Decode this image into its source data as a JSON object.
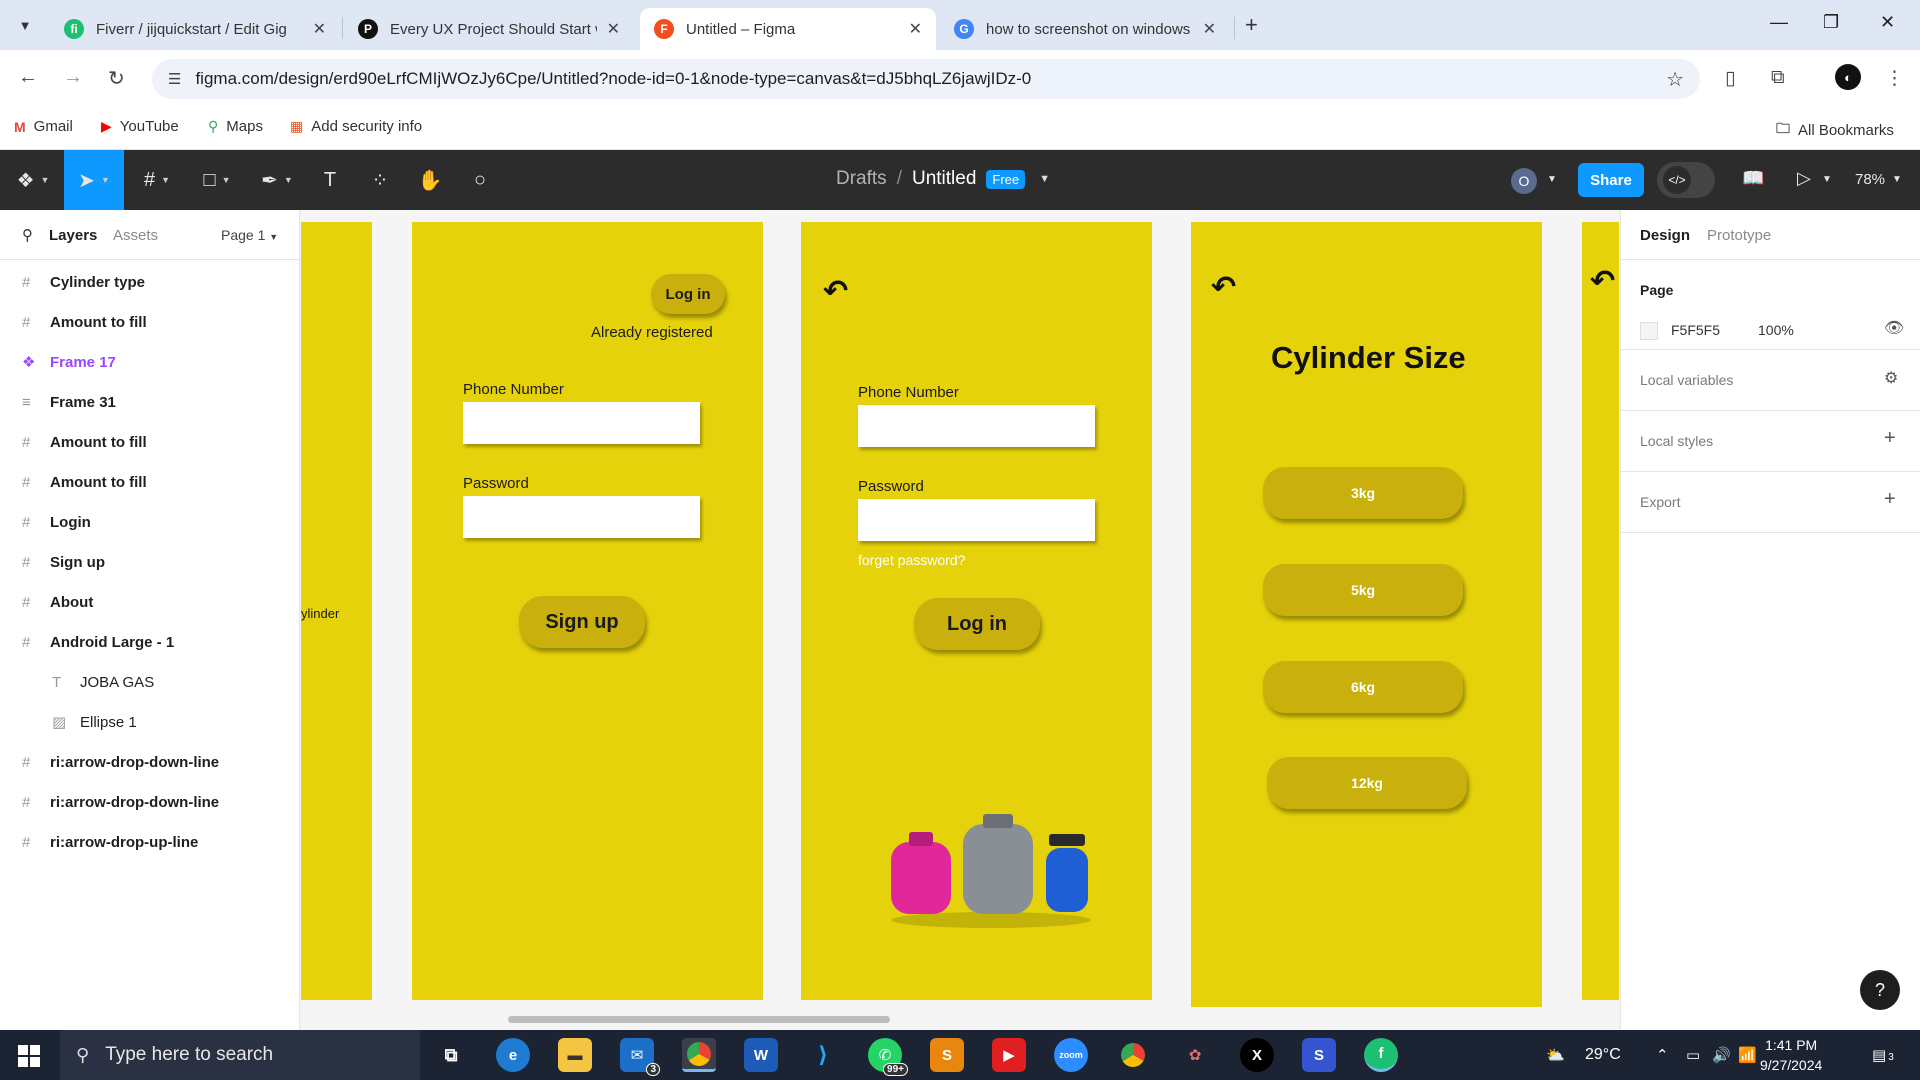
{
  "browser": {
    "tabs": [
      {
        "title": "Fiverr / jijquickstart / Edit Gig",
        "icon": "fiverr-icon",
        "color": "#1dbf73",
        "glyph": "fi"
      },
      {
        "title": "Every UX Project Should Start w",
        "icon": "pinterest-icon",
        "color": "#111111",
        "glyph": "P"
      },
      {
        "title": "Untitled – Figma",
        "icon": "figma-icon",
        "color": "#f24e1e",
        "glyph": "F"
      },
      {
        "title": "how to screenshot on windows",
        "icon": "google-icon",
        "color": "#4285f4",
        "glyph": "G"
      }
    ],
    "active_tab": 2,
    "url": "figma.com/design/erd90eLrfCMIjWOzJy6Cpe/Untitled?node-id=0-1&node-type=canvas&t=dJ5bhqLZ6jawjIDz-0",
    "bookmarks": [
      {
        "label": "Gmail",
        "icon": "gmail-icon",
        "color": "#ea4335"
      },
      {
        "label": "YouTube",
        "icon": "youtube-icon",
        "color": "#ff0000"
      },
      {
        "label": "Maps",
        "icon": "maps-icon",
        "color": "#34a853"
      },
      {
        "label": "Add security info",
        "icon": "microsoft-icon",
        "color": "#f25022"
      }
    ],
    "all_bookmarks": "All Bookmarks"
  },
  "figma": {
    "breadcrumb_root": "Drafts",
    "file_name": "Untitled",
    "plan_badge": "Free",
    "avatar": "O",
    "share_label": "Share",
    "zoom": "78%"
  },
  "left_panel": {
    "tab_layers": "Layers",
    "tab_assets": "Assets",
    "page_selector": "Page 1",
    "layers": [
      {
        "label": "Cylinder type",
        "icon": "frame-icon",
        "kind": "frame"
      },
      {
        "label": "Amount to fill",
        "icon": "frame-icon",
        "kind": "frame"
      },
      {
        "label": "Frame 17",
        "icon": "component-icon",
        "kind": "component"
      },
      {
        "label": "Frame 31",
        "icon": "auto-layout-icon",
        "kind": "frame"
      },
      {
        "label": "Amount to fill",
        "icon": "frame-icon",
        "kind": "frame"
      },
      {
        "label": "Amount to fill",
        "icon": "frame-icon",
        "kind": "frame"
      },
      {
        "label": "Login",
        "icon": "frame-icon",
        "kind": "frame"
      },
      {
        "label": "Sign up",
        "icon": "frame-icon",
        "kind": "frame"
      },
      {
        "label": "About",
        "icon": "frame-icon",
        "kind": "frame"
      },
      {
        "label": "Android Large - 1",
        "icon": "frame-icon",
        "kind": "frame"
      },
      {
        "label": "JOBA GAS",
        "icon": "text-icon",
        "kind": "child"
      },
      {
        "label": "Ellipse 1",
        "icon": "image-icon",
        "kind": "child"
      },
      {
        "label": "ri:arrow-drop-down-line",
        "icon": "frame-icon",
        "kind": "frame"
      },
      {
        "label": "ri:arrow-drop-down-line",
        "icon": "frame-icon",
        "kind": "frame"
      },
      {
        "label": "ri:arrow-drop-up-line",
        "icon": "frame-icon",
        "kind": "frame"
      }
    ]
  },
  "canvas": {
    "partial_text": "ylinder",
    "signup_frame": {
      "login_button": "Log in",
      "already_registered": "Already registered",
      "phone_label": "Phone Number",
      "password_label": "Password",
      "signup_button": "Sign up"
    },
    "login_frame": {
      "phone_label": "Phone Number",
      "password_label": "Password",
      "forgot": "forget password?",
      "login_button": "Log in"
    },
    "size_frame": {
      "title": "Cylinder Size",
      "sizes": [
        "3kg",
        "5kg",
        "6kg",
        "12kg"
      ]
    },
    "frame_color": "#e6d20a",
    "button_color": "#c9b00c"
  },
  "right_panel": {
    "tab_design": "Design",
    "tab_prototype": "Prototype",
    "page_section": "Page",
    "page_color": "F5F5F5",
    "page_opacity": "100%",
    "local_variables": "Local variables",
    "local_styles": "Local styles",
    "export": "Export"
  },
  "taskbar": {
    "search_placeholder": "Type here to search",
    "weather": "29°C",
    "time": "1:41 PM",
    "date": "9/27/2024",
    "mail_badge": "3",
    "whatsapp_badge": "99+",
    "notif_badge": "3"
  }
}
